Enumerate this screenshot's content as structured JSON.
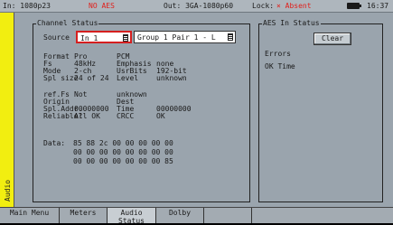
{
  "status": {
    "input": "In: 1080p23",
    "aes": "NO AES",
    "output": "Out: 3GA-1080p60",
    "lock_label": "Lock:",
    "lock_state": "× Absent",
    "time": "16:37"
  },
  "sidebar_label": "Audio",
  "channel_status": {
    "title": "Channel Status",
    "source_label": "Source",
    "source_value": "In 1",
    "group_value": "Group 1 Pair 1 - L",
    "rows1": [
      [
        "Format",
        "Pro",
        "PCM",
        ""
      ],
      [
        "Fs",
        "48kHz",
        "Emphasis",
        "none"
      ],
      [
        "Mode",
        "2-ch",
        "UsrBits",
        "192-bit"
      ],
      [
        "Spl size",
        "24 of 24",
        "Level",
        "unknown"
      ]
    ],
    "rows2": [
      [
        "ref.Fs",
        "Not",
        "unknown",
        ""
      ],
      [
        "Origin",
        "",
        "Dest",
        ""
      ],
      [
        "Spl.Addr.",
        "00000000",
        "Time",
        "00000000"
      ],
      [
        "Reliable?",
        "All OK",
        "CRCC",
        "OK"
      ]
    ],
    "data_label": "Data:",
    "data_lines": [
      "85 88 2c 00 00 00 00 00",
      "00 00 00 00 00 00 00 00",
      "00 00 00 00 00 00 00 85"
    ]
  },
  "aes_status": {
    "title": "AES In Status",
    "clear_label": "Clear",
    "errors_label": "Errors",
    "ok_time_label": "OK Time"
  },
  "softkeys": [
    {
      "label": "Main Menu",
      "active": false
    },
    {
      "label": "Meters",
      "active": false
    },
    {
      "label": "Audio\nStatus",
      "active": true
    },
    {
      "label": "Dolby",
      "active": false
    },
    {
      "label": "",
      "active": false
    },
    {
      "label": "",
      "active": false
    }
  ],
  "colors": {
    "accent_red": "#e0201c",
    "strip_yellow": "#f2ee10"
  }
}
